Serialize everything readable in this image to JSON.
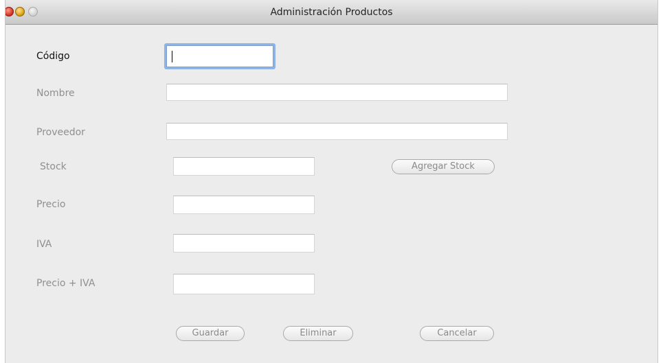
{
  "window": {
    "title": "Administración Productos"
  },
  "form": {
    "codigo": {
      "label": "Código",
      "value": ""
    },
    "nombre": {
      "label": "Nombre",
      "value": ""
    },
    "proveedor": {
      "label": "Proveedor",
      "value": ""
    },
    "stock": {
      "label": "Stock",
      "value": ""
    },
    "precio": {
      "label": "Precio",
      "value": ""
    },
    "iva": {
      "label": "IVA",
      "value": ""
    },
    "precio_iva": {
      "label": "Precio + IVA",
      "value": ""
    }
  },
  "buttons": {
    "agregar_stock": "Agregar Stock",
    "guardar": "Guardar",
    "eliminar": "Eliminar",
    "cancelar": "Cancelar"
  },
  "colors": {
    "focus_ring": "#8eb4e6",
    "disabled_text": "#8f8f8f"
  }
}
